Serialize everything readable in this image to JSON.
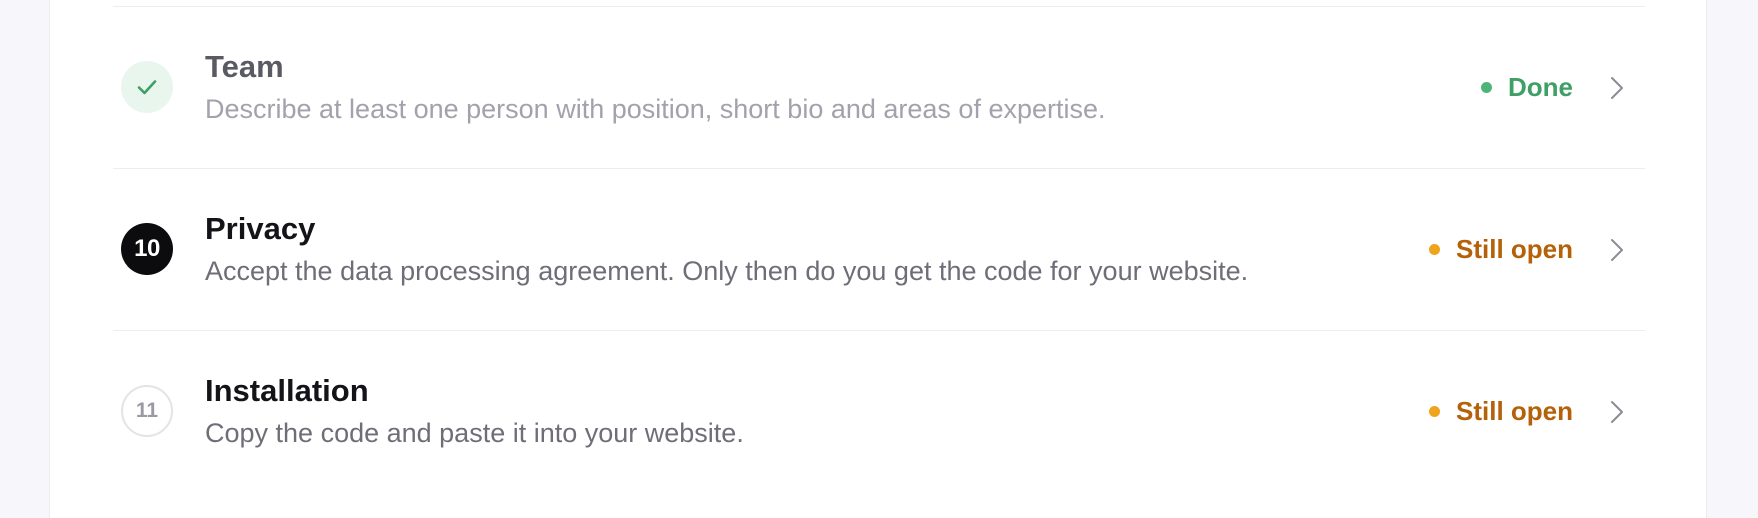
{
  "colors": {
    "done": "#3f9f66",
    "done_dot": "#4fb477",
    "open": "#b4610a",
    "open_dot": "#f0a31c",
    "chevron": "#8c8c96"
  },
  "steps": [
    {
      "badge_type": "check",
      "badge_icon": "check-icon",
      "title": "Team",
      "description": "Describe at least one person with position, short bio and areas of expertise.",
      "status": "Done",
      "status_kind": "done"
    },
    {
      "badge_type": "number",
      "badge_text": "10",
      "title": "Privacy",
      "description": "Accept the data processing agreement. Only then do you get the code for your website.",
      "status": "Still open",
      "status_kind": "open"
    },
    {
      "badge_type": "number",
      "badge_text": "11",
      "title": "Installation",
      "description": "Copy the code and paste it into your website.",
      "status": "Still open",
      "status_kind": "open"
    }
  ]
}
